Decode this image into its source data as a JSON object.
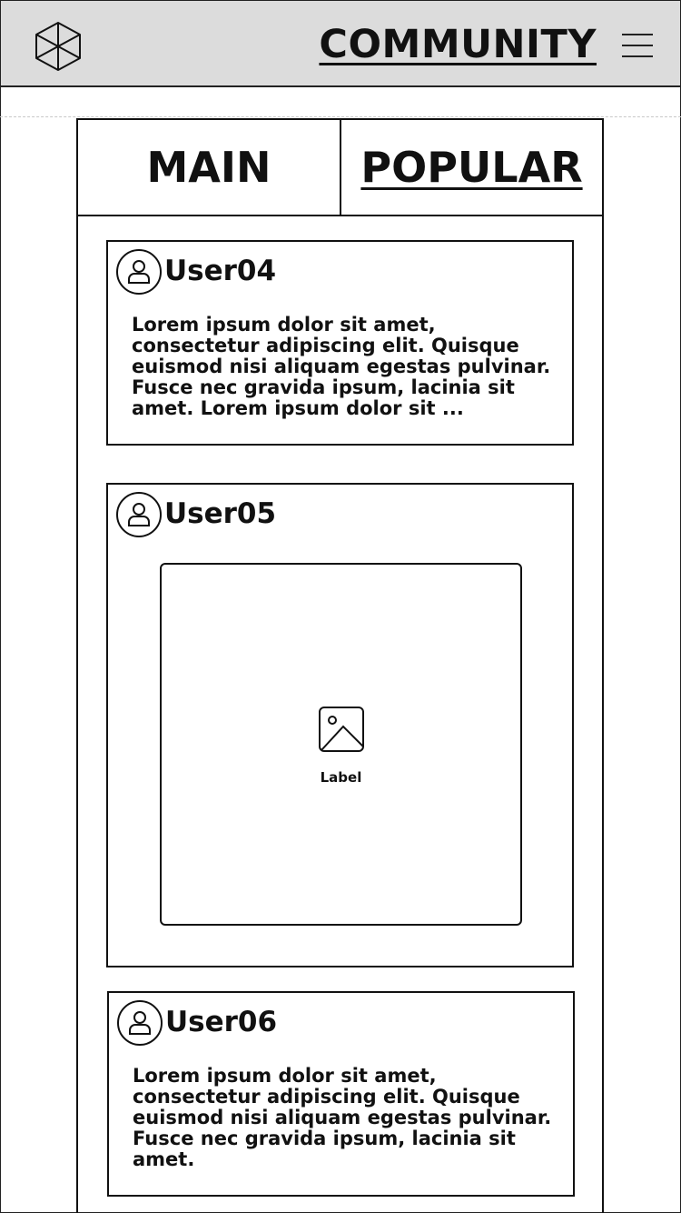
{
  "header": {
    "title": "COMMUNITY",
    "logo_icon": "cube-logo-icon",
    "menu_icon": "hamburger-menu-icon",
    "background": "#dcdcdc"
  },
  "tabs": [
    {
      "label": "MAIN",
      "selected": false
    },
    {
      "label": "POPULAR",
      "selected": true
    }
  ],
  "posts": [
    {
      "username": "User04",
      "avatar_icon": "user-avatar-icon",
      "text": "Lorem ipsum dolor sit amet, consectetur adipiscing elit. Quisque euismod nisi aliquam egestas pulvinar. Fusce nec gravida ipsum, lacinia sit amet. Lorem ipsum dolor sit ..."
    },
    {
      "username": "User05",
      "avatar_icon": "user-avatar-icon",
      "image": {
        "icon": "image-placeholder-icon",
        "label": "Label"
      }
    },
    {
      "username": "User06",
      "avatar_icon": "user-avatar-icon",
      "text": "Lorem ipsum dolor sit amet, consectetur adipiscing elit. Quisque euismod nisi aliquam egestas pulvinar. Fusce nec gravida ipsum, lacinia sit amet."
    }
  ]
}
